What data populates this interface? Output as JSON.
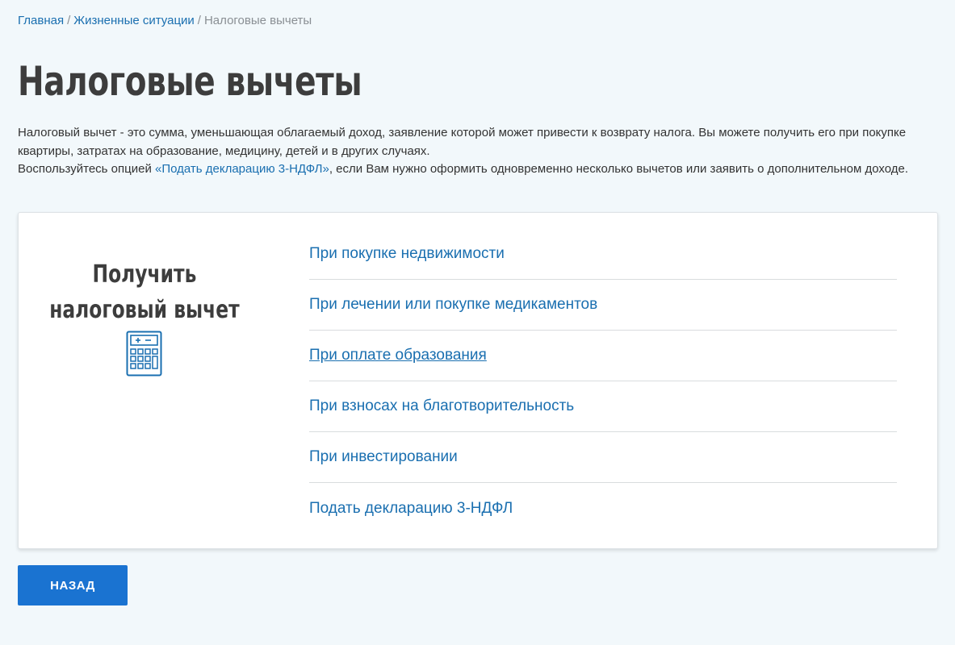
{
  "breadcrumb": {
    "items": [
      "Главная",
      "Жизненные ситуации"
    ],
    "current": "Налоговые вычеты",
    "separator": "/"
  },
  "page_title": "Налоговые вычеты",
  "intro": {
    "line1": "Налоговый вычет - это сумма, уменьшающая облагаемый доход, заявление которой может привести к возврату налога. Вы можете получить его при покупке квартиры, затратах на образование, медицину, детей и в других случаях.",
    "line2_before": "Воспользуйтесь опцией ",
    "line2_link": "«Подать декларацию 3-НДФЛ»",
    "line2_after": ", если Вам нужно оформить одновременно несколько вычетов или заявить о дополнительном доходе."
  },
  "card": {
    "title_line1": "Получить",
    "title_line2": "налоговый вычет",
    "icon": "calculator-icon",
    "links": [
      "При покупке недвижимости",
      "При лечении или покупке медикаментов",
      "При оплате образования",
      "При взносах на благотворительность",
      "При инвестировании",
      "Подать декларацию 3-НДФЛ"
    ]
  },
  "back_button": "НАЗАД",
  "colors": {
    "background": "#f2f8fb",
    "link": "#1a6fb0",
    "button": "#1a73d1",
    "title": "#3d3d3d"
  }
}
